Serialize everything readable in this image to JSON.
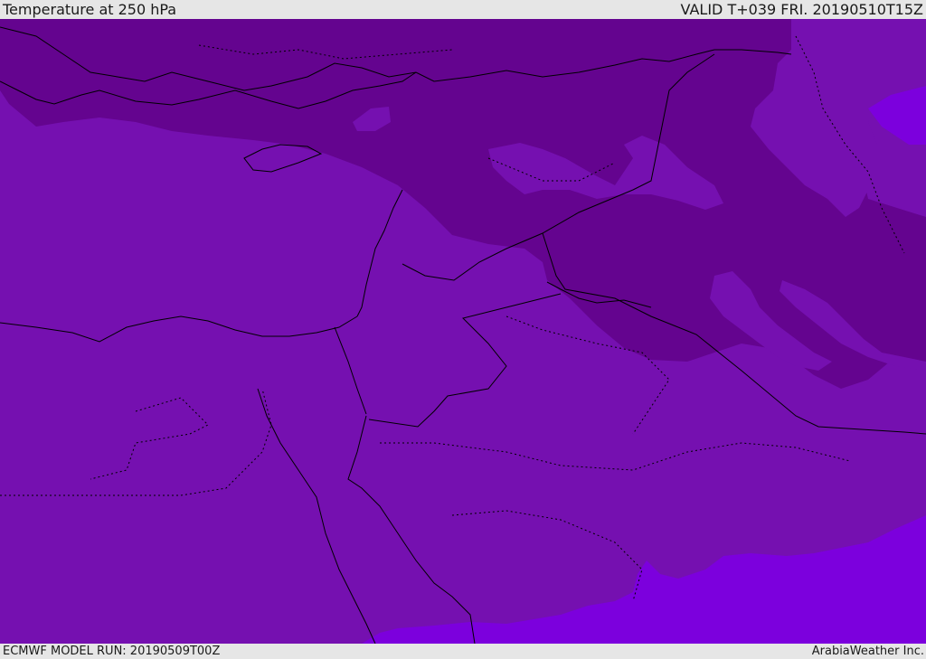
{
  "header": {
    "title": "Temperature at 250 hPa",
    "valid_time": "VALID T+039 FRI. 20190510T15Z"
  },
  "footer": {
    "model_run": "ECMWF MODEL RUN: 20190509T00Z",
    "credit": "ArabiaWeather Inc."
  },
  "map": {
    "field": "Temperature at 250 hPa",
    "colors": {
      "base": "#7510b0",
      "dark": "#64048f",
      "bright": "#7c00dd",
      "border": "#000000"
    }
  }
}
